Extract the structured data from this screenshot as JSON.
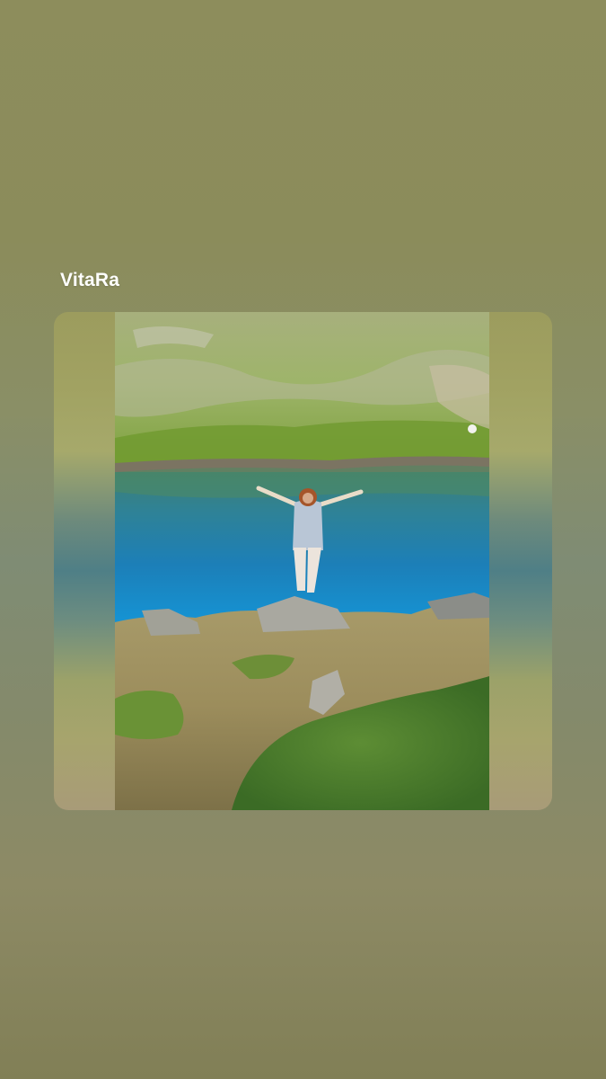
{
  "story": {
    "author": "VitaRa"
  },
  "colors": {
    "background": "#8a8d62",
    "lake": "#1f8ec7",
    "grass": "#6f9a3a"
  }
}
